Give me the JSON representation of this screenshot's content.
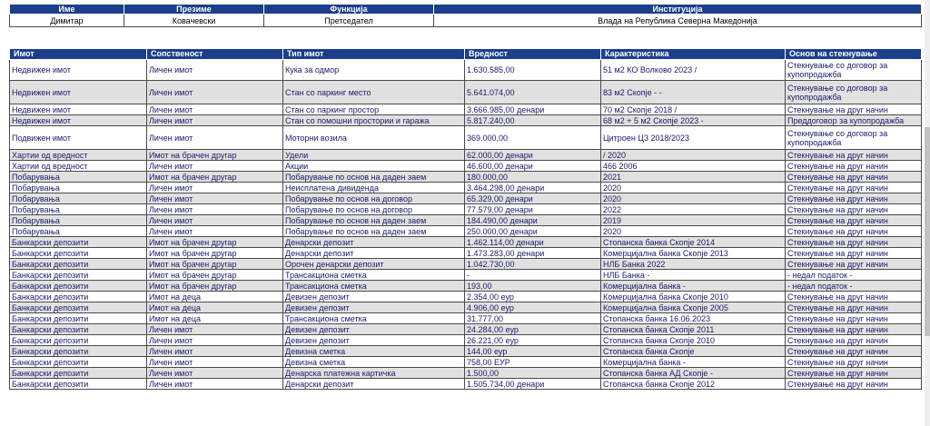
{
  "person": {
    "headers": [
      "Име",
      "Презиме",
      "Функција",
      "Институција"
    ],
    "values": [
      "Димитар",
      "Ковачевски",
      "Претседател",
      "Влада на Република Северна Македонија"
    ]
  },
  "assets": {
    "headers": [
      "Имот",
      "Сопственост",
      "Тип имот",
      "Вредност",
      "Карактеристика",
      "Основ на стекнување"
    ],
    "rows": [
      [
        "Недвижен имот",
        "Личен имот",
        "Куќа за одмор",
        "1.630.585,00",
        "51 м2 КО Волково 2023 /",
        "Стекнување со договор за купопродажба"
      ],
      [
        "Недвижен имот",
        "Личен имот",
        "Стан со паркинг место",
        "5.641.074,00",
        "83 м2 Скопје - -",
        "Стекнување со договор за купопродажба"
      ],
      [
        "Недвижен имот",
        "Личен имот",
        "Стан со паркинг простор",
        "3.666.985,00 денари",
        "70 м2 Скопје 2018 /",
        "Стекнување на друг начин"
      ],
      [
        "Недвижен имот",
        "Личен имот",
        "Стан со помошни простории и гаража",
        "5.817.240,00",
        "68 м2 + 5 м2 Скопје 2023 -",
        "Преддоговор за купопродажба"
      ],
      [
        "Подвижен имот",
        "Личен имот",
        "Моторни возила",
        "369.000,00",
        "Цитроен Ц3 2018/2023",
        "Стекнување со договор за купопродажба"
      ],
      [
        "Хартии од вредност",
        "Имот на брачен другар",
        "Удели",
        "62.000,00 денари",
        "/ 2020",
        "Стекнување на друг начин"
      ],
      [
        "Хартии од вредност",
        "Личен имот",
        "Акции",
        "46.600,00 денари",
        "466 2006",
        "Стекнување на друг начин"
      ],
      [
        "Побарувања",
        "Имот на брачен другар",
        "Побарување по основ на даден заем",
        "180.000,00",
        "2021",
        "Стекнување на друг начин"
      ],
      [
        "Побарувања",
        "Личен имот",
        "Неисплатена дивиденда",
        "3.464.298,00 денари",
        "2020",
        "Стекнување на друг начин"
      ],
      [
        "Побарувања",
        "Личен имот",
        "Побарување по основ на договор",
        "65.329,00 денари",
        "2020",
        "Стекнување на друг начин"
      ],
      [
        "Побарувања",
        "Личен имот",
        "Побарување по основ на договор",
        "77.579,00 денари",
        "2022",
        "Стекнување на друг начин"
      ],
      [
        "Побарувања",
        "Личен имот",
        "Побарување по основ на даден заем",
        "184.490,00 денари",
        "2019",
        "Стекнување на друг начин"
      ],
      [
        "Побарувања",
        "Личен имот",
        "Побарување по основ на даден заем",
        "250.000,00 денари",
        "2020",
        "Стекнување на друг начин"
      ],
      [
        "Банкарски депозити",
        "Имот на брачен другар",
        "Денарски депозит",
        "1.462.114,00 денари",
        "Стопанска банка Скопје 2014",
        "Стекнување на друг начин"
      ],
      [
        "Банкарски депозити",
        "Имот на брачен другар",
        "Денарски депозит",
        "1.473.283,00 денари",
        "Комерцијална банка Скопје 2013",
        "Стекнување на друг начин"
      ],
      [
        "Банкарски депозити",
        "Имот на брачен другар",
        "Орочен денарски депозит",
        "1.042.730,00",
        "НЛБ Банка 2022",
        "Стекнување на друг начин"
      ],
      [
        "Банкарски депозити",
        "Имот на брачен другар",
        "Трансакциона сметка",
        "-",
        "НЛБ Банка -",
        "- недал податок -"
      ],
      [
        "Банкарски депозити",
        "Имот на брачен другар",
        "Трансакциона сметка",
        "193,00",
        "Комерцијална банка -",
        "- недал податок -"
      ],
      [
        "Банкарски депозити",
        "Имот на деца",
        "Девизен депозит",
        "2.354,00 еур",
        "Комерцијална банка Скопје 2010",
        "Стекнување на друг начин"
      ],
      [
        "Банкарски депозити",
        "Имот на деца",
        "Девизен депозит",
        "4.906,00 еур",
        "Комерцијална банка Скопје 2005",
        "Стекнување на друг начин"
      ],
      [
        "Банкарски депозити",
        "Имот на деца",
        "Трансакциона сметка",
        "31.777,00",
        "Стопанска банка 16.06.2023",
        "Стекнување на друг начин"
      ],
      [
        "Банкарски депозити",
        "Личен имот",
        "Девизен депозит",
        "24.284,00 еур",
        "Стопанска банка Скопје 2011",
        "Стекнување на друг начин"
      ],
      [
        "Банкарски депозити",
        "Личен имот",
        "Девизен депозит",
        "26.221,00 еур",
        "Стопанска банка Скопје 2010",
        "Стекнување на друг начин"
      ],
      [
        "Банкарски депозити",
        "Личен имот",
        "Девизна сметка",
        "144,00 еур",
        "Стопанска банка Скопје",
        "Стекнување на друг начин"
      ],
      [
        "Банкарски депозити",
        "Личен имот",
        "Девизна сметка",
        "758,00 ЕУР",
        "Комерцијална банка -",
        "Стекнување на друг начин"
      ],
      [
        "Банкарски депозити",
        "Личен имот",
        "Денарска платежна картичка",
        "1.500,00",
        "Стопанска банка АД Скопје -",
        "Стекнување на друг начин"
      ],
      [
        "Банкарски депозити",
        "Личен имот",
        "Денарски депозит",
        "1.505.734,00 денари",
        "Стопанска банка Скопје 2012",
        "Стекнување на друг начин"
      ]
    ]
  },
  "colors": {
    "header_bg": "#1b3f8b",
    "row_alt": "#e1e1e1",
    "text": "#1a1a6e"
  }
}
